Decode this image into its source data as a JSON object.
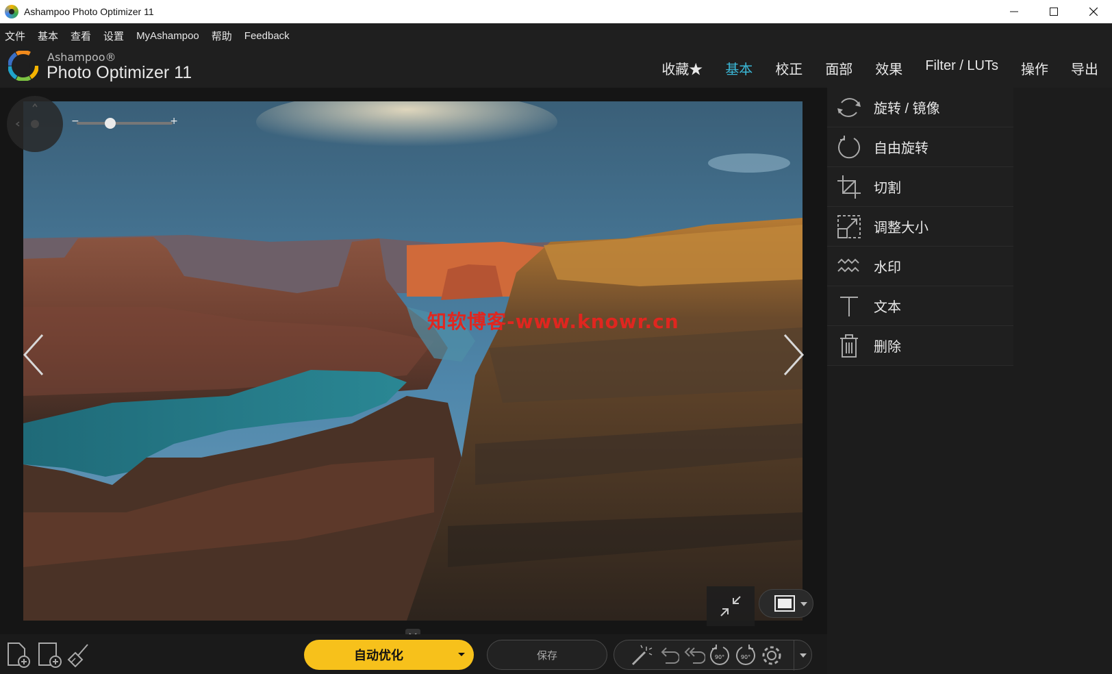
{
  "window": {
    "title": "Ashampoo Photo Optimizer 11"
  },
  "menu": [
    "文件",
    "基本",
    "查看",
    "设置",
    "MyAshampoo",
    "帮助",
    "Feedback"
  ],
  "brand": {
    "small": "Ashampoo®",
    "big": "Photo Optimizer 11"
  },
  "tabs": [
    {
      "label": "收藏★",
      "active": false
    },
    {
      "label": "基本",
      "active": true
    },
    {
      "label": "校正",
      "active": false
    },
    {
      "label": "面部",
      "active": false
    },
    {
      "label": "效果",
      "active": false
    },
    {
      "label": "Filter / LUTs",
      "active": false
    },
    {
      "label": "操作",
      "active": false
    },
    {
      "label": "导出",
      "active": false
    }
  ],
  "viewer": {
    "watermark": "知软博客-www.knowr.cn",
    "zoom": {
      "minus": "−",
      "plus": "+",
      "level": 0.35
    }
  },
  "tools": [
    {
      "label": "旋转 / 镜像",
      "icon": "rotate-mirror-icon"
    },
    {
      "label": "自由旋转",
      "icon": "free-rotate-icon"
    },
    {
      "label": "切割",
      "icon": "crop-icon"
    },
    {
      "label": "调整大小",
      "icon": "resize-icon"
    },
    {
      "label": "水印",
      "icon": "watermark-icon"
    },
    {
      "label": "文本",
      "icon": "text-icon"
    },
    {
      "label": "删除",
      "icon": "delete-icon"
    }
  ],
  "bottom": {
    "auto_label": "自动优化",
    "save_label": "保存",
    "rotate_badge": "90°"
  },
  "colors": {
    "accent": "#3bb7d6",
    "auto_button": "#f7c11b",
    "watermark": "#e0261f"
  }
}
